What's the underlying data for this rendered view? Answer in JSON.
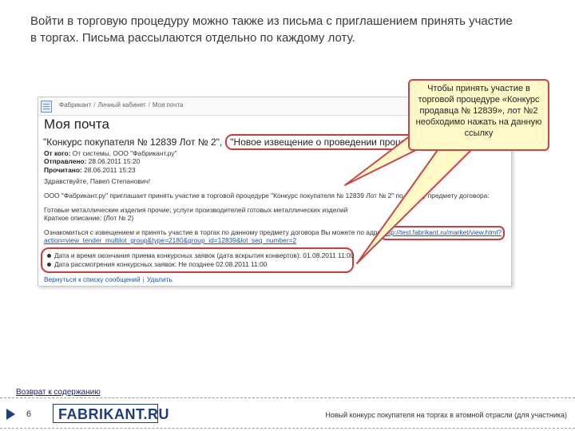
{
  "intro": {
    "line1": "Войти в торговую процедуру можно также из письма с приглашением принять участие",
    "line2": "в торгах. Письма рассылаются отдельно по каждому лоту."
  },
  "shot": {
    "breadcrumb": [
      "Фабрикант",
      "Личный кабинет",
      "Моя почта"
    ],
    "page_title": "Моя почта",
    "subject_main": "\"Конкурс покупателя № 12839 Лот № 2\"",
    "subject_tag": "\"Новое извещение о проведении процедуры\"",
    "meta": {
      "from_label": "От кого:",
      "from_value": "От системы, ООО \"Фабрикант.ру\"",
      "sent_label": "Отправлено:",
      "sent_value": "28.06.2011 15:20",
      "read_label": "Прочитано:",
      "read_value": "28.06.2011 15:23"
    },
    "greeting": "Здравствуйте, Павел Степанович!",
    "invite": "ООО \"Фабрикант.ру\" приглашает принять участие в торговой процедуре \"Конкурс покупателя № 12839 Лот № 2\" по ...ному предмету договора:",
    "subject_items": "Готовые металлические изделия прочие; услуги производителей готовых металлических изделий",
    "short_desc": "Краткое описание: (Лот № 2)",
    "link_intro": "Ознакомиться с извещением и принять участие в торгах по данному предмету договора Вы можете по адресу:",
    "link_url1": "http://test.fabrikant.ru/market/view.html?",
    "link_url2": "action=view_tender_multilot_group&type=2180&group_id=12839&lot_seq_number=2",
    "dates": [
      "Дата и время окончания приема конкурсных заявок (дата вскрытия конвертов): 01.08.2011 11:00",
      "Дата рассмотрения конкурсных заявок: Не позднее 02.08.2011 11:00"
    ],
    "back_to_list": "Вернуться к списку сообщений",
    "delete": "Удалить"
  },
  "callout": {
    "text": "Чтобы принять участие в торговой процедуре «Конкурс продавца № 12839», лот №2 необходимо нажать на данную ссылку"
  },
  "footer": {
    "back_link": "Возврат к содержанию",
    "page_number": "6",
    "logo": "FABRIKANT.RU",
    "caption": "Новый конкурс покупателя на торгах в атомной отрасли (для участника)"
  }
}
